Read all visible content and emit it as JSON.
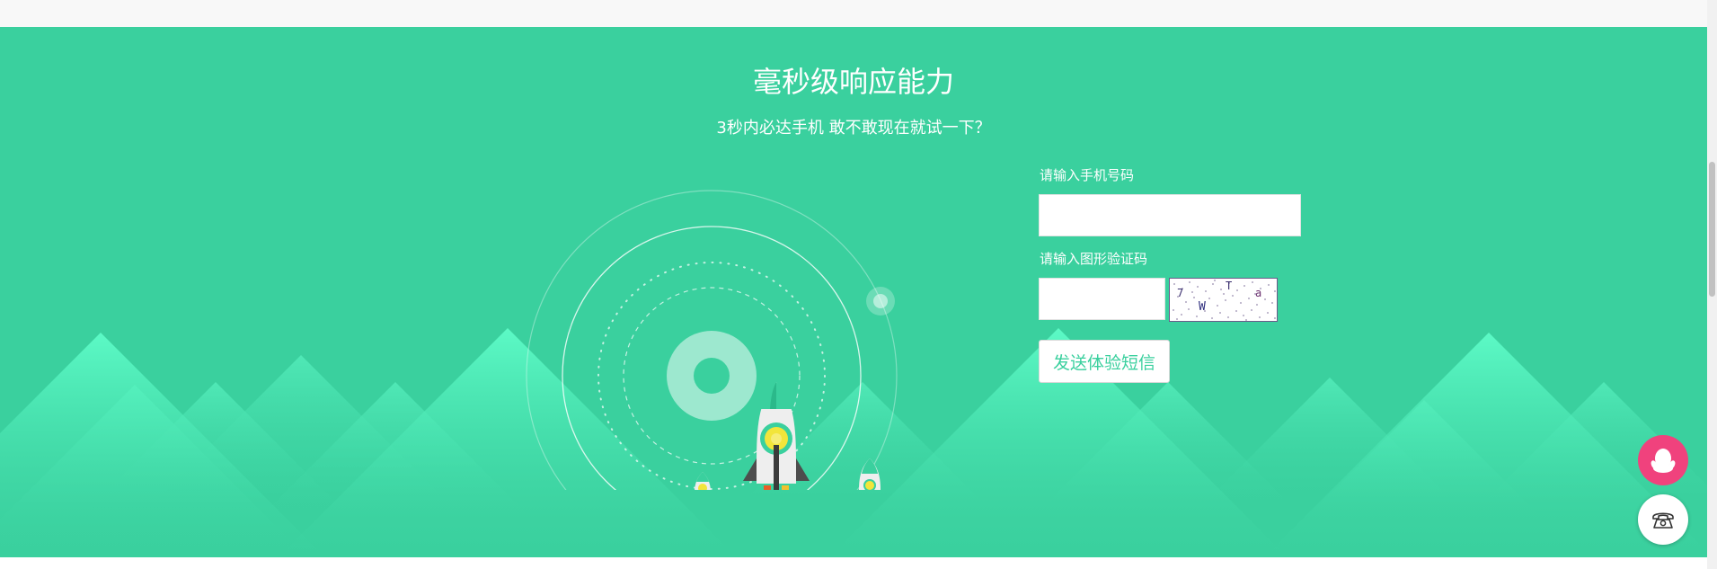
{
  "hero": {
    "title": "毫秒级响应能力",
    "subtitle": "3秒内必达手机 敢不敢现在就试一下？"
  },
  "form": {
    "phone_label": "请输入手机号码",
    "phone_value": "",
    "captcha_label": "请输入图形验证码",
    "captcha_value": "",
    "captcha_text": "7 T a W",
    "send_label": "发送体验短信"
  },
  "floating_buttons": [
    {
      "name": "qq-penguin-icon"
    },
    {
      "name": "telephone-icon"
    }
  ],
  "colors": {
    "background": "#3ad09e",
    "mountain_light": "#5efcc8",
    "accent_pink": "#f0427d",
    "button_text": "#3ad09e"
  }
}
